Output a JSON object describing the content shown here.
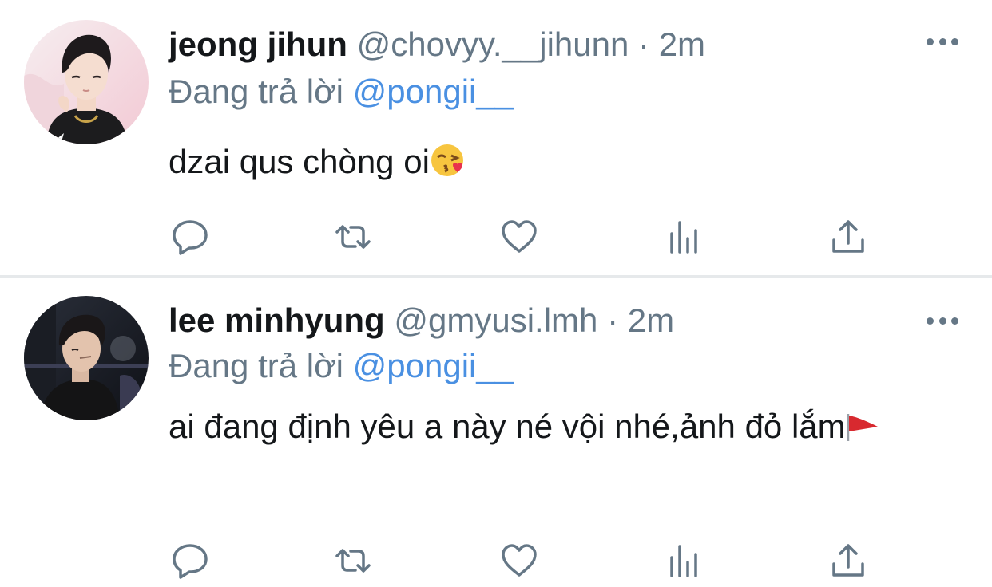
{
  "tweets": [
    {
      "name": "jeong jihun",
      "handle": "@chovyy.__jihunn",
      "separator": "·",
      "time": "2m",
      "reply_prefix": "Đang trả lời",
      "reply_to": "@pongii__",
      "text": "dzai qus chòng oi",
      "emoji": "face-blowing-kiss",
      "avatar": "avatar-photo"
    },
    {
      "name": "lee minhyung",
      "handle": "@gmyusi.lmh",
      "separator": "·",
      "time": "2m",
      "reply_prefix": "Đang trả lời",
      "reply_to": "@pongii__",
      "text": "ai đang định yêu a này né vội nhé,ảnh đỏ lắm",
      "emoji": "red-flag",
      "avatar": "avatar-photo"
    }
  ],
  "actions": [
    "reply-icon",
    "retweet-icon",
    "like-icon",
    "analytics-icon",
    "share-icon"
  ],
  "colors": {
    "name": "#14171a",
    "secondary": "#657786",
    "mention": "#4a90e2",
    "divider": "#e6e9eb"
  }
}
